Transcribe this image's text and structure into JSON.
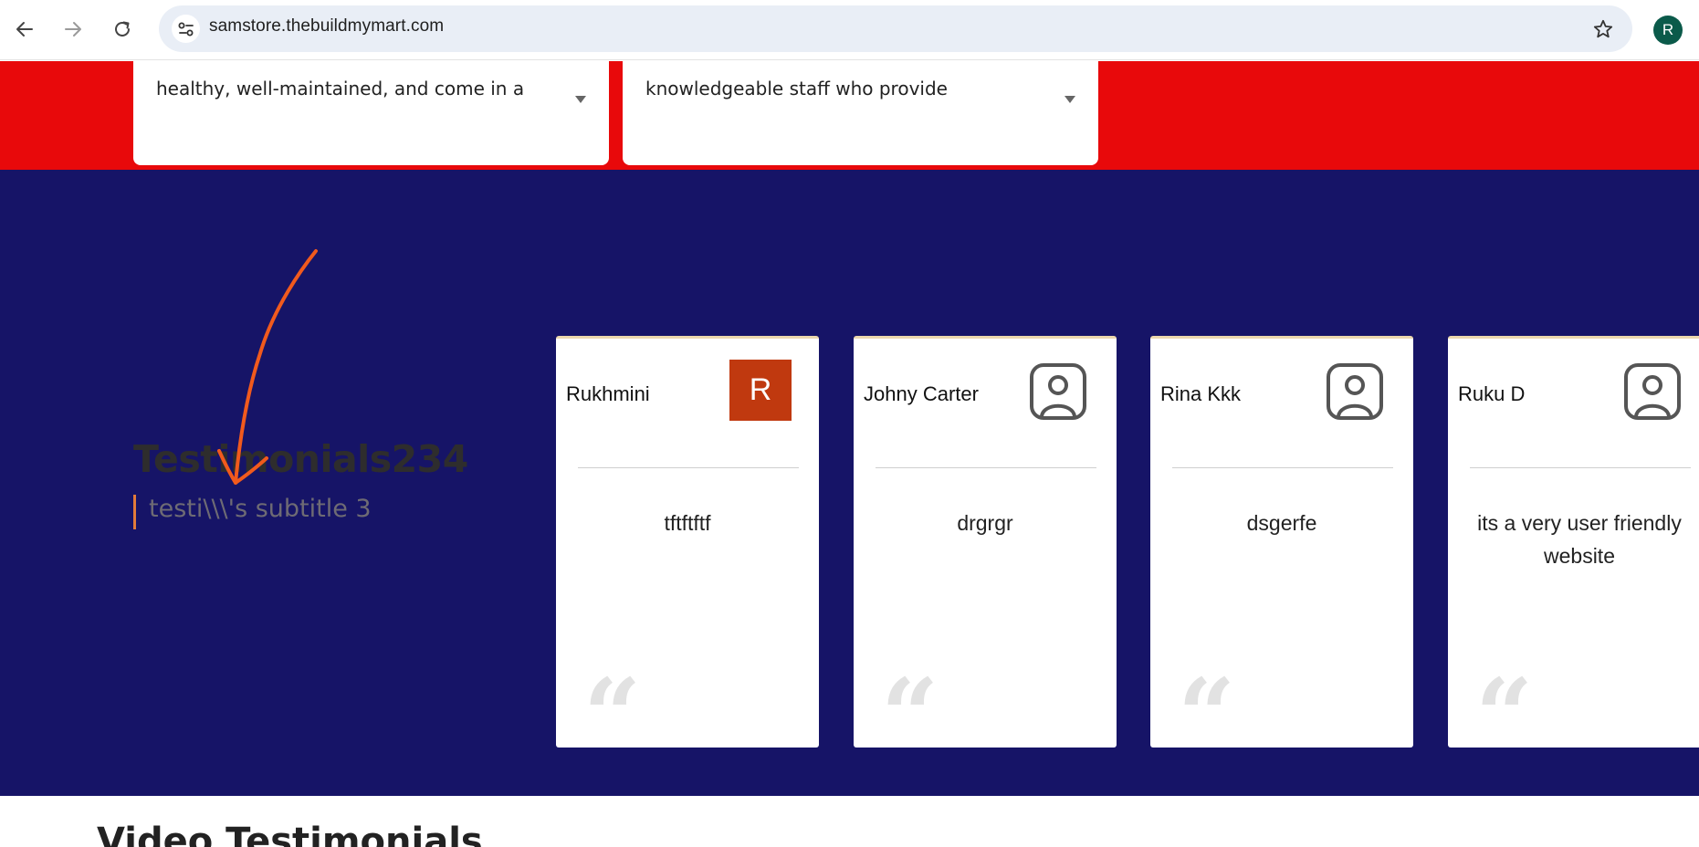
{
  "browser": {
    "url": "samstore.thebuildmymart.com",
    "profile_initial": "R",
    "icons": {
      "back": "back-arrow-icon",
      "forward": "forward-arrow-icon",
      "reload": "reload-icon",
      "site_settings": "tune-icon",
      "bookmark": "star-icon"
    }
  },
  "faq": {
    "items": [
      {
        "text": "healthy, well-maintained, and come in a"
      },
      {
        "text": "knowledgeable staff who provide"
      }
    ]
  },
  "testimonials": {
    "title": "Testimonials234",
    "subtitle": "testi\\\\\\'s subtitle 3",
    "cards": [
      {
        "name": "Rukhmini",
        "avatar": "R",
        "text": "tftftftf"
      },
      {
        "name": "Johny Carter",
        "avatar": "user-icon",
        "text": "drgrgr"
      },
      {
        "name": "Rina Kkk",
        "avatar": "user-icon",
        "text": "dsgerfe"
      },
      {
        "name": "Ruku D",
        "avatar": "user-icon",
        "text": "its a very user friendly website"
      }
    ],
    "quote_mark": "“"
  },
  "video_section": {
    "title": "Video Testimonials"
  },
  "colors": {
    "red_band": "#e8090b",
    "navy_section": "#161467",
    "accent_orange": "#e27b3a",
    "avatar_rust": "#c0390f",
    "card_top_border": "#ecd8ad",
    "annotation": "#f15a1d"
  }
}
